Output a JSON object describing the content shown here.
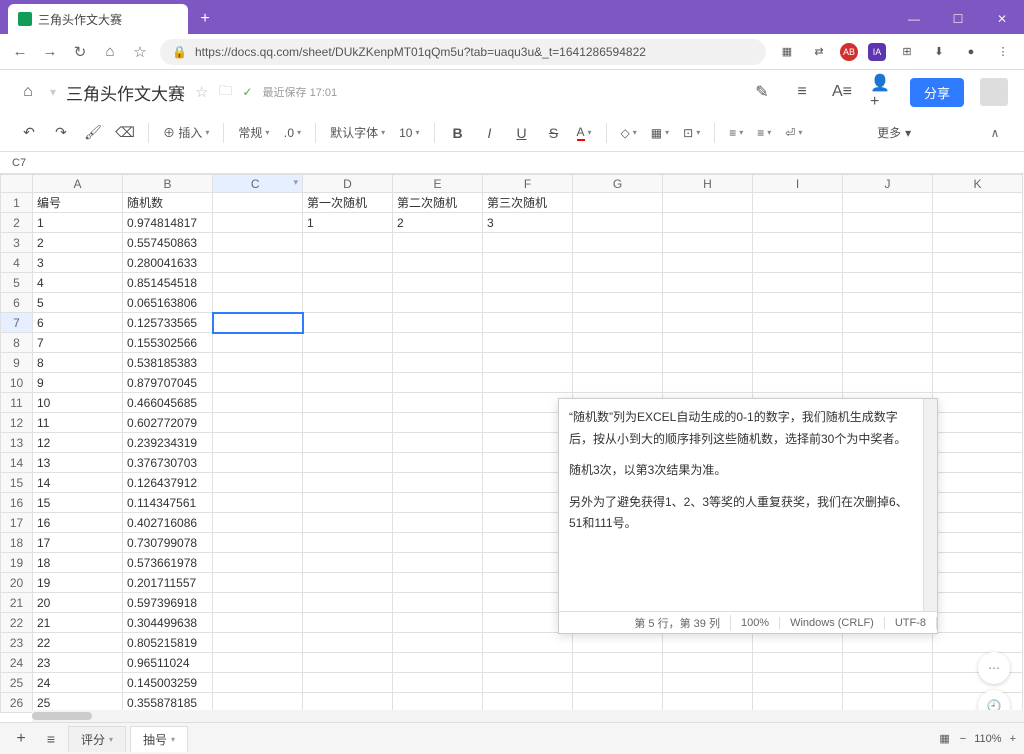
{
  "browser": {
    "tab_title": "三角头作文大赛",
    "add_tab": "+",
    "win_min": "—",
    "win_max": "☐",
    "win_close": "✕",
    "back": "←",
    "forward": "→",
    "reload": "↻",
    "home": "⌂",
    "star": "☆",
    "url": "https://docs.qq.com/sheet/DUkZKenpMT01qQm5u?tab=uaqu3u&_t=1641286594822",
    "lock": "🔒",
    "ext_qr": "▦",
    "ext_trans": "⇄",
    "ext_ab": "AB",
    "ext_ia": "IA",
    "ext_grid": "⊞",
    "ext_dl": "⬇",
    "ext_av": "●",
    "ext_menu": "⋮"
  },
  "doc": {
    "home_icon": "⌂",
    "title": "三角头作文大赛",
    "star": "☆",
    "folder": "🗀",
    "sync": "✓",
    "last_save": "最近保存 17:01",
    "h_edit": "✎",
    "h_list": "≡",
    "h_font": "A≡",
    "h_person": "👤+",
    "share": "分享"
  },
  "toolbar": {
    "undo": "↶",
    "redo": "↷",
    "paint": "🖌",
    "clear": "⌫",
    "insert": "⊕ 插入",
    "normal": "常规",
    "decimal": "․0",
    "font": "默认字体",
    "size": "10",
    "bold": "B",
    "italic": "I",
    "underline": "U",
    "strike": "S",
    "txtcolor": "A",
    "fill": "◇",
    "border": "▦",
    "merge": "⊡",
    "halign": "≡",
    "valign": "≡",
    "wrap": "⏎",
    "more": "更多",
    "collapse": "∧"
  },
  "cell_ref": "C7",
  "columns": [
    "A",
    "B",
    "C",
    "D",
    "E",
    "F",
    "G",
    "H",
    "I",
    "J",
    "K"
  ],
  "headers": {
    "A": "编号",
    "B": "随机数",
    "D": "第一次随机",
    "E": "第二次随机",
    "F": "第三次随机"
  },
  "row2": {
    "D": "1",
    "E": "2",
    "F": "3"
  },
  "data_rows": [
    {
      "n": "1",
      "v": "0.974814817"
    },
    {
      "n": "2",
      "v": "0.557450863"
    },
    {
      "n": "3",
      "v": "0.280041633"
    },
    {
      "n": "4",
      "v": "0.851454518"
    },
    {
      "n": "5",
      "v": "0.065163806"
    },
    {
      "n": "6",
      "v": "0.125733565"
    },
    {
      "n": "7",
      "v": "0.155302566"
    },
    {
      "n": "8",
      "v": "0.538185383"
    },
    {
      "n": "9",
      "v": "0.879707045"
    },
    {
      "n": "10",
      "v": "0.466045685"
    },
    {
      "n": "11",
      "v": "0.602772079"
    },
    {
      "n": "12",
      "v": "0.239234319"
    },
    {
      "n": "13",
      "v": "0.376730703"
    },
    {
      "n": "14",
      "v": "0.126437912"
    },
    {
      "n": "15",
      "v": "0.114347561"
    },
    {
      "n": "16",
      "v": "0.402716086"
    },
    {
      "n": "17",
      "v": "0.730799078"
    },
    {
      "n": "18",
      "v": "0.573661978"
    },
    {
      "n": "19",
      "v": "0.201711557"
    },
    {
      "n": "20",
      "v": "0.597396918"
    },
    {
      "n": "21",
      "v": "0.304499638"
    },
    {
      "n": "22",
      "v": "0.805215819"
    },
    {
      "n": "23",
      "v": "0.96511024"
    },
    {
      "n": "24",
      "v": "0.145003259"
    },
    {
      "n": "25",
      "v": "0.355878185"
    }
  ],
  "note": {
    "p1": "“随机数”列为EXCEL自动生成的0-1的数字，我们随机生成数字后，按从小到大的顺序排列这些随机数，选择前30个为中奖者。",
    "p2": "随机3次，以第3次结果为准。",
    "p3": "另外为了避免获得1、2、3等奖的人重复获奖，我们在次删掉6、51和111号。",
    "status_pos": "第 5 行，第 39 列",
    "status_zoom": "100%",
    "status_enc": "Windows (CRLF)",
    "status_charset": "UTF-8"
  },
  "tabs": {
    "add": "+",
    "menu": "≡",
    "tab1": "评分",
    "tab2": "抽号",
    "caret": "▾",
    "grid_ico": "▦",
    "zoom_minus": "−",
    "zoom_val": "110%",
    "zoom_plus": "+"
  }
}
